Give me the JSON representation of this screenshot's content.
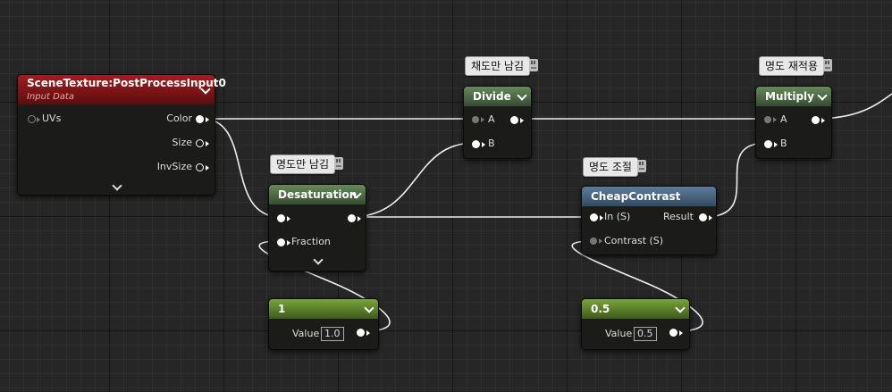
{
  "colors": {
    "wire": "#f0f0f0",
    "header_green": "#4f6e46",
    "header_red": "#8a1618",
    "header_blue": "#4b6a88",
    "header_lime": "#5e8a2a"
  },
  "scene_texture": {
    "title": "SceneTexture:PostProcessInput0",
    "subtitle": "Input Data",
    "inputs": [
      {
        "label": "UVs",
        "icon": "hollow-pin-icon"
      }
    ],
    "outputs": [
      {
        "label": "Color"
      },
      {
        "label": "Size"
      },
      {
        "label": "InvSize"
      }
    ]
  },
  "desaturation": {
    "comment": "명도만 남김",
    "title": "Desaturation",
    "input_fraction": "Fraction"
  },
  "divide": {
    "comment": "채도만 남김",
    "title": "Divide",
    "input_a": "A",
    "input_b": "B"
  },
  "cheap_contrast": {
    "comment": "명도 조절",
    "title": "CheapContrast",
    "input_in": "In (S)",
    "input_contrast": "Contrast (S)",
    "output": "Result"
  },
  "multiply": {
    "comment": "명도 재적용",
    "title": "Multiply",
    "input_a": "A",
    "input_b": "B"
  },
  "const1": {
    "title": "1",
    "value_label": "Value",
    "value": "1.0"
  },
  "const2": {
    "title": "0.5",
    "value_label": "Value",
    "value": "0.5"
  }
}
